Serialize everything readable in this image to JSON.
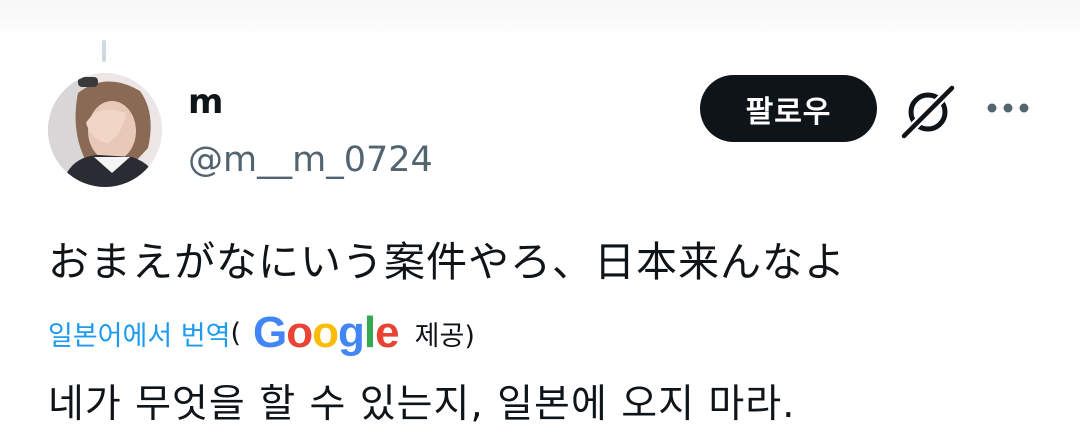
{
  "author": {
    "display_name": "m",
    "handle": "@m__m_0724",
    "avatar_icon": "profile-photo"
  },
  "actions": {
    "follow_label": "팔로우",
    "grok_icon": "grok-icon",
    "more_icon": "more-icon"
  },
  "tweet": {
    "text": "おまえがなにいう案件やろ、日本来んなよ",
    "translate_link": "일본어에서 번역",
    "paren_open": "(",
    "google_logo": {
      "g1": "G",
      "o1": "o",
      "o2": "o",
      "g2": "g",
      "l": "l",
      "e": "e"
    },
    "provided_by": "제공)",
    "translated_text": "네가 무엇을 할 수 있는지, 일본에 오지 마라."
  },
  "colors": {
    "link": "#1d9bf0",
    "secondary_text": "#536471",
    "button_bg": "#0f1419"
  }
}
